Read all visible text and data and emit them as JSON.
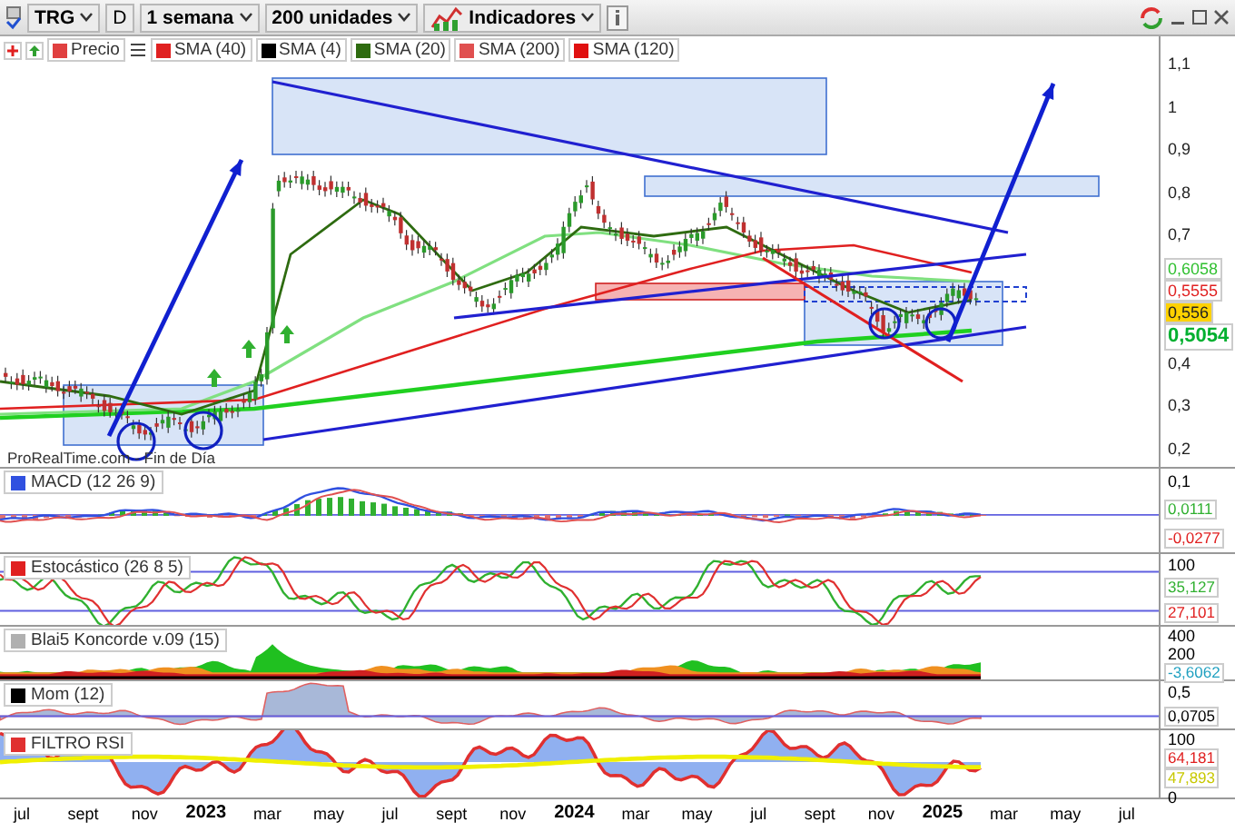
{
  "toolbar": {
    "symbol": "TRG",
    "mode": "D",
    "period": "1 semana",
    "units": "200 unidades",
    "indicators": "Indicadores"
  },
  "legend": [
    {
      "label": "Precio",
      "color": "#e04040"
    },
    {
      "label": "SMA (40)",
      "color": "#e02020"
    },
    {
      "label": "SMA (4)",
      "color": "#000000"
    },
    {
      "label": "SMA (20)",
      "color": "#2e6b10"
    },
    {
      "label": "SMA (200)",
      "color": "#e05050"
    },
    {
      "label": "SMA (120)",
      "color": "#e01010"
    }
  ],
  "main_chart": {
    "source": "ProRealTime.com - Fin de Día",
    "axis": [
      {
        "kind": "tick",
        "text": "1,1"
      },
      {
        "kind": "tick",
        "text": "1"
      },
      {
        "kind": "tick",
        "text": "0,9"
      },
      {
        "kind": "tick",
        "text": "0,8"
      },
      {
        "kind": "tick",
        "text": "0,7"
      },
      {
        "kind": "tag",
        "text": "0,6058",
        "color": "#30c030"
      },
      {
        "kind": "tag",
        "text": "0,5555",
        "color": "#e02020"
      },
      {
        "kind": "highlight",
        "text": "0,556",
        "color": "#ffd200"
      },
      {
        "kind": "bold_tag",
        "text": "0,5054",
        "color": "#00b030"
      },
      {
        "kind": "tick",
        "text": "0,4"
      },
      {
        "kind": "tick",
        "text": "0,3"
      },
      {
        "kind": "tick",
        "text": "0,2"
      }
    ]
  },
  "panels": [
    {
      "kind": "macd",
      "title": "MACD (12 26 9)",
      "color": "#3050e0",
      "axis": [
        {
          "kind": "tick",
          "text": "0,1"
        },
        {
          "kind": "tag",
          "text": "0,0111",
          "color": "#30b030"
        },
        {
          "kind": "tag",
          "text": "-0,0277",
          "color": "#e02020"
        }
      ]
    },
    {
      "kind": "stochastic",
      "title": "Estocástico (26 8 5)",
      "color": "#e02020",
      "axis": [
        {
          "kind": "tick",
          "text": "100"
        },
        {
          "kind": "tag",
          "text": "35,127",
          "color": "#30b030"
        },
        {
          "kind": "tag",
          "text": "27,101",
          "color": "#e02020"
        }
      ]
    },
    {
      "kind": "koncorde",
      "title": "Blai5 Koncorde v.09 (15)",
      "color": "#b0b0b0",
      "axis": [
        {
          "kind": "tick",
          "text": "400"
        },
        {
          "kind": "tick",
          "text": "200"
        },
        {
          "kind": "tag",
          "text": "-3,6062",
          "color": "#20a0c0"
        }
      ]
    },
    {
      "kind": "momentum",
      "title": "Mom (12)",
      "color": "#000000",
      "axis": [
        {
          "kind": "tick",
          "text": "0,5"
        },
        {
          "kind": "tag",
          "text": "0,0705",
          "color": "#000000"
        }
      ]
    },
    {
      "kind": "rsi",
      "title": "FILTRO RSI",
      "color": "#e03030",
      "axis": [
        {
          "kind": "tick",
          "text": "100"
        },
        {
          "kind": "tag",
          "text": "64,181",
          "color": "#e02020"
        },
        {
          "kind": "tag",
          "text": "47,893",
          "color": "#c8c800"
        },
        {
          "kind": "tick",
          "text": "0"
        }
      ]
    }
  ],
  "x_axis": [
    {
      "text": "jul",
      "kind": "month"
    },
    {
      "text": "sept",
      "kind": "month"
    },
    {
      "text": "nov",
      "kind": "month"
    },
    {
      "text": "2023",
      "kind": "year"
    },
    {
      "text": "mar",
      "kind": "month"
    },
    {
      "text": "may",
      "kind": "month"
    },
    {
      "text": "jul",
      "kind": "month"
    },
    {
      "text": "sept",
      "kind": "month"
    },
    {
      "text": "nov",
      "kind": "month"
    },
    {
      "text": "2024",
      "kind": "year"
    },
    {
      "text": "mar",
      "kind": "month"
    },
    {
      "text": "may",
      "kind": "month"
    },
    {
      "text": "jul",
      "kind": "month"
    },
    {
      "text": "sept",
      "kind": "month"
    },
    {
      "text": "nov",
      "kind": "month"
    },
    {
      "text": "2025",
      "kind": "year"
    },
    {
      "text": "mar",
      "kind": "month"
    },
    {
      "text": "may",
      "kind": "month"
    },
    {
      "text": "jul",
      "kind": "month"
    }
  ]
}
